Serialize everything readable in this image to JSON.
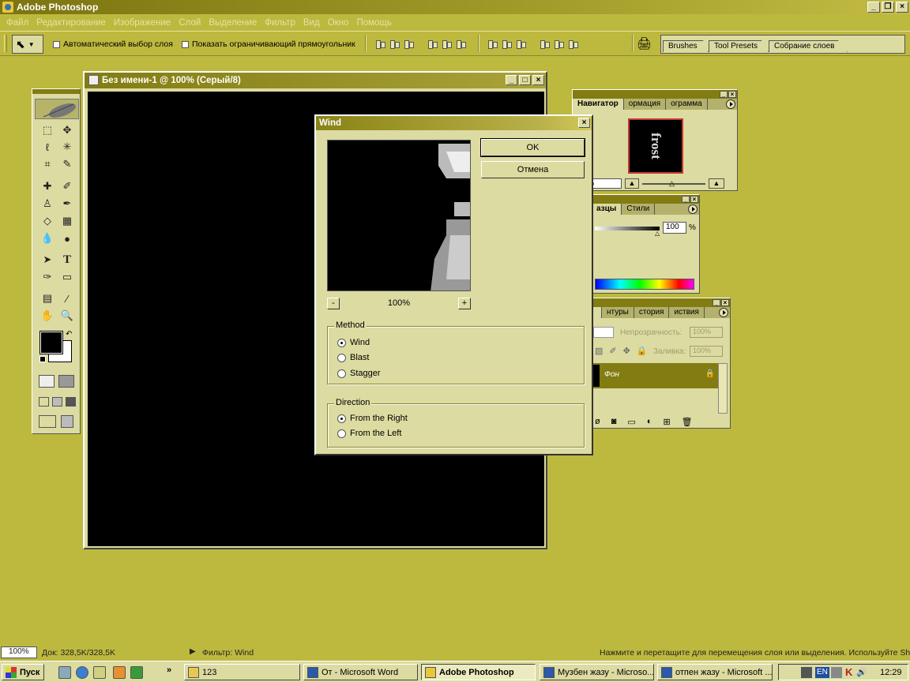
{
  "app": {
    "title": "Adobe Photoshop"
  },
  "menu": [
    "Файл",
    "Редактирование",
    "Изображение",
    "Слой",
    "Выделение",
    "Фильтр",
    "Вид",
    "Окно",
    "Помощь"
  ],
  "options": {
    "auto_select": "Автоматический выбор слоя",
    "show_bounds": "Показать ограничивающий прямоугольник"
  },
  "palette_well": [
    "Brushes",
    "Tool Presets",
    "Собрание слоев"
  ],
  "document": {
    "title": "Без имени-1 @ 100% (Серый/8)"
  },
  "navigator": {
    "tabs": [
      "Навигатор",
      "ормация",
      "ограмма"
    ],
    "thumb_text": "frost",
    "zoom": "%"
  },
  "swatches": {
    "tabs": [
      "азцы",
      "Стили"
    ],
    "value": "100",
    "unit": "%"
  },
  "layers": {
    "tabs": [
      "",
      "нтуры",
      "стория",
      "иствия"
    ],
    "opacity_label": "Непрозрачность:",
    "opacity_value": "100%",
    "fill_label": "Заливка:",
    "fill_value": "100%",
    "layer_name": "Фон"
  },
  "dialog": {
    "title": "Wind",
    "ok": "OK",
    "cancel": "Отмена",
    "zoom_minus": "-",
    "zoom_plus": "+",
    "zoom": "100%",
    "method": {
      "label": "Method",
      "options": [
        "Wind",
        "Blast",
        "Stagger"
      ],
      "selected": "Wind"
    },
    "direction": {
      "label": "Direction",
      "options": [
        "From the Right",
        "From the Left"
      ],
      "selected": "From the Right"
    }
  },
  "status": {
    "zoom": "100%",
    "doc": "Док: 328,5K/328,5K",
    "filter": "Фильтр: Wind",
    "hint": "Нажмите и перетащите для перемещения слоя или выделения. Используйте Shif"
  },
  "taskbar": {
    "start": "Пуск",
    "more": "»",
    "buttons": [
      "123",
      "От - Microsoft Word",
      "Adobe Photoshop",
      "Музбен жазу - Microso...",
      "отпен жазу - Microsoft ..."
    ],
    "active": "Adobe Photoshop",
    "lang": "EN",
    "time": "12:29"
  }
}
